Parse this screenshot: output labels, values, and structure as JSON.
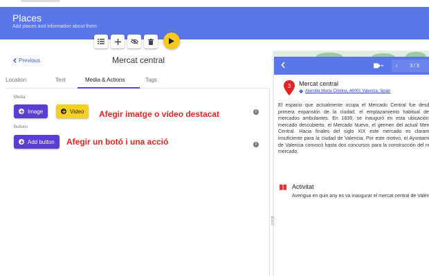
{
  "header": {
    "title": "Places",
    "subtitle": "Add places and information about them"
  },
  "toolbar": {
    "icons": [
      "list-icon",
      "plus-icon",
      "eye-off-icon",
      "trash-icon",
      "play-icon"
    ]
  },
  "editor": {
    "previous_label": "Previous",
    "title": "Mercat central",
    "tabs": [
      "Location",
      "Text",
      "Media & Actions",
      "Tags"
    ],
    "active_tab": "Media & Actions",
    "media_label": "Media",
    "image_button": "Image",
    "video_button": "Video",
    "media_annotation": "Afegir imatge o vídeo destacat",
    "buttons_label": "Buttons",
    "add_button": "Add button",
    "buttons_annotation": "Afegir un botó i una acció"
  },
  "preview": {
    "pager": "3 / 3",
    "marker_number": "3",
    "place_name": "Mercat central",
    "address": "Avenida María Cristina, 46001 Valencia, Spain",
    "description": "El espacio que actualmente ocupa el Mercado Central fue desde la primera expansión de la ciudad, el emplazamiento habitual de los mercados ambulantes. En 1839, se inauguró en esta ubicación, un mercado descubierto, el Mercado Nuevo, el germen del actual Mercado Central. Hacia finales del siglo XIX este mercado es claramente insuficiente para la ciudad de Valencia. Por este motivo, el Ayuntamiento de Valencia convocó hasta dos concursos para la construcción del nuevo mercado.",
    "activity_title": "Activitat",
    "activity_text": "Averigua en quin any es va inaugurar el mercat central de València."
  },
  "colors": {
    "header": "#5b76e8",
    "primary": "#5a3ed2",
    "accent": "#f4d023",
    "annotation": "#e52222",
    "marker": "#e52222"
  }
}
